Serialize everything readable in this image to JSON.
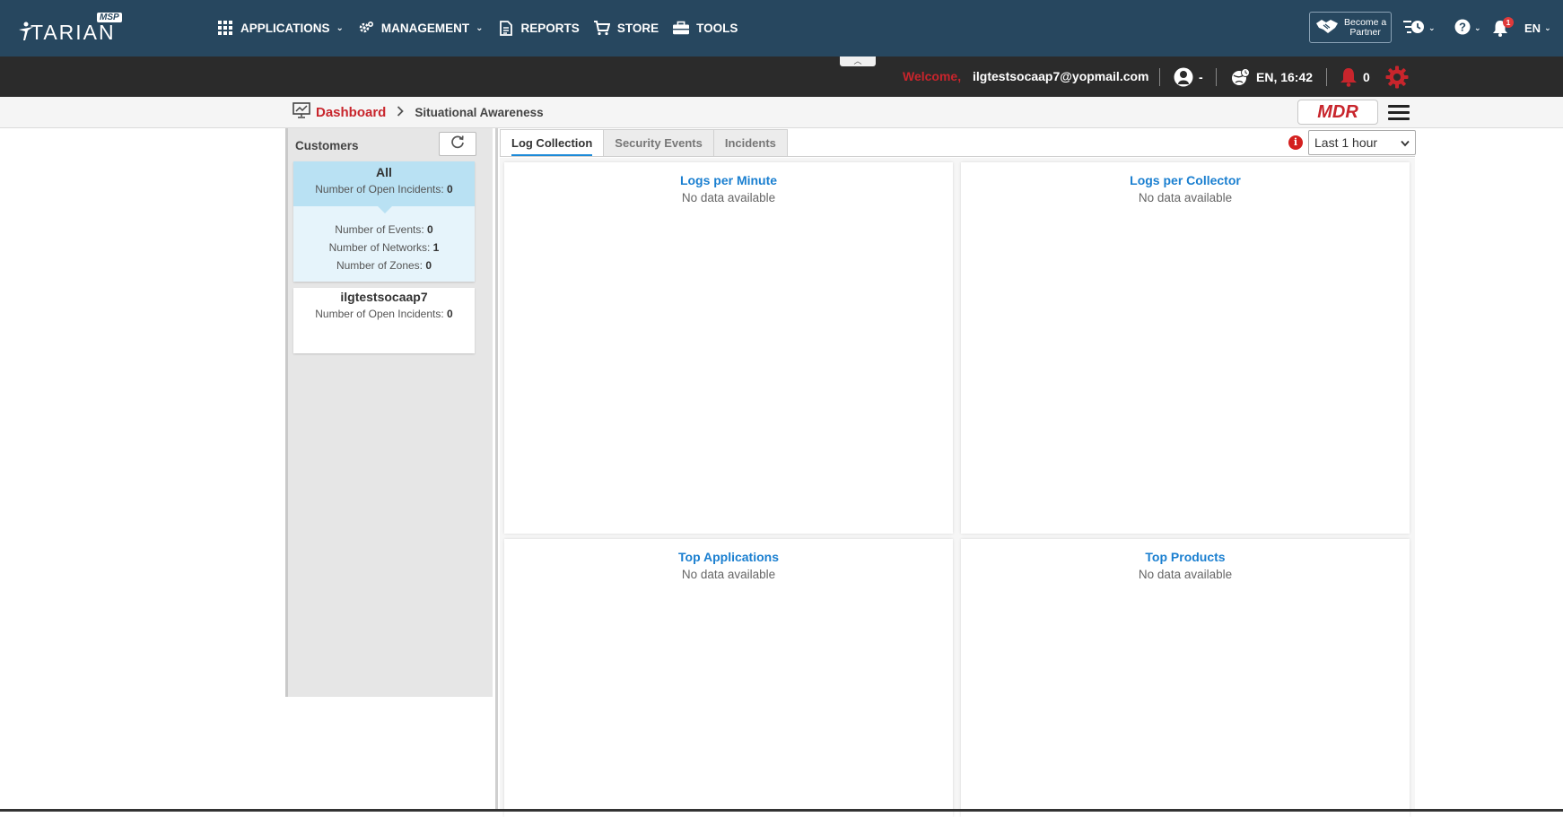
{
  "brand": {
    "name": "TARIAN",
    "tag": "MSP"
  },
  "menu": [
    {
      "label": "APPLICATIONS",
      "icon": "grid-icon",
      "dropdown": true
    },
    {
      "label": "MANAGEMENT",
      "icon": "gear-icon",
      "dropdown": true
    },
    {
      "label": "REPORTS",
      "icon": "document-icon",
      "dropdown": false
    },
    {
      "label": "STORE",
      "icon": "cart-icon",
      "dropdown": false
    },
    {
      "label": "TOOLS",
      "icon": "toolbox-icon",
      "dropdown": false
    }
  ],
  "header_right": {
    "partner_label_1": "Become a",
    "partner_label_2": "Partner",
    "notifications_count": "1",
    "language": "EN"
  },
  "subbar": {
    "welcome": "Welcome,",
    "email": "ilgtestsocaap7@yopmail.com",
    "user_status": "-",
    "locale_time": "EN, 16:42",
    "alerts_count": "0"
  },
  "breadcrumb": {
    "home": "Dashboard",
    "current": "Situational Awareness",
    "mdr_label": "MDR"
  },
  "customers": {
    "title": "Customers",
    "cards": [
      {
        "name": "All",
        "open_incidents_label": "Number of Open Incidents:",
        "open_incidents": "0",
        "events_label": "Number of Events:",
        "events": "0",
        "networks_label": "Number of Networks:",
        "networks": "1",
        "zones_label": "Number of Zones:",
        "zones": "0"
      },
      {
        "name": "ilgtestsocaap7",
        "open_incidents_label": "Number of Open Incidents:",
        "open_incidents": "0"
      }
    ]
  },
  "tabs": [
    {
      "label": "Log Collection",
      "active": true
    },
    {
      "label": "Security Events",
      "active": false
    },
    {
      "label": "Incidents",
      "active": false
    }
  ],
  "time_range": {
    "selected": "Last 1 hour"
  },
  "widgets": [
    {
      "title": "Logs per Minute",
      "message": "No data available"
    },
    {
      "title": "Logs per Collector",
      "message": "No data available"
    },
    {
      "title": "Top Applications",
      "message": "No data available"
    },
    {
      "title": "Top Products",
      "message": "No data available"
    }
  ],
  "colors": {
    "nav_bg": "#27475f",
    "subbar_bg": "#2b2b2b",
    "accent_red": "#c8252c",
    "link_blue": "#1a7fd0",
    "selected_card": "#b9e1f3"
  }
}
